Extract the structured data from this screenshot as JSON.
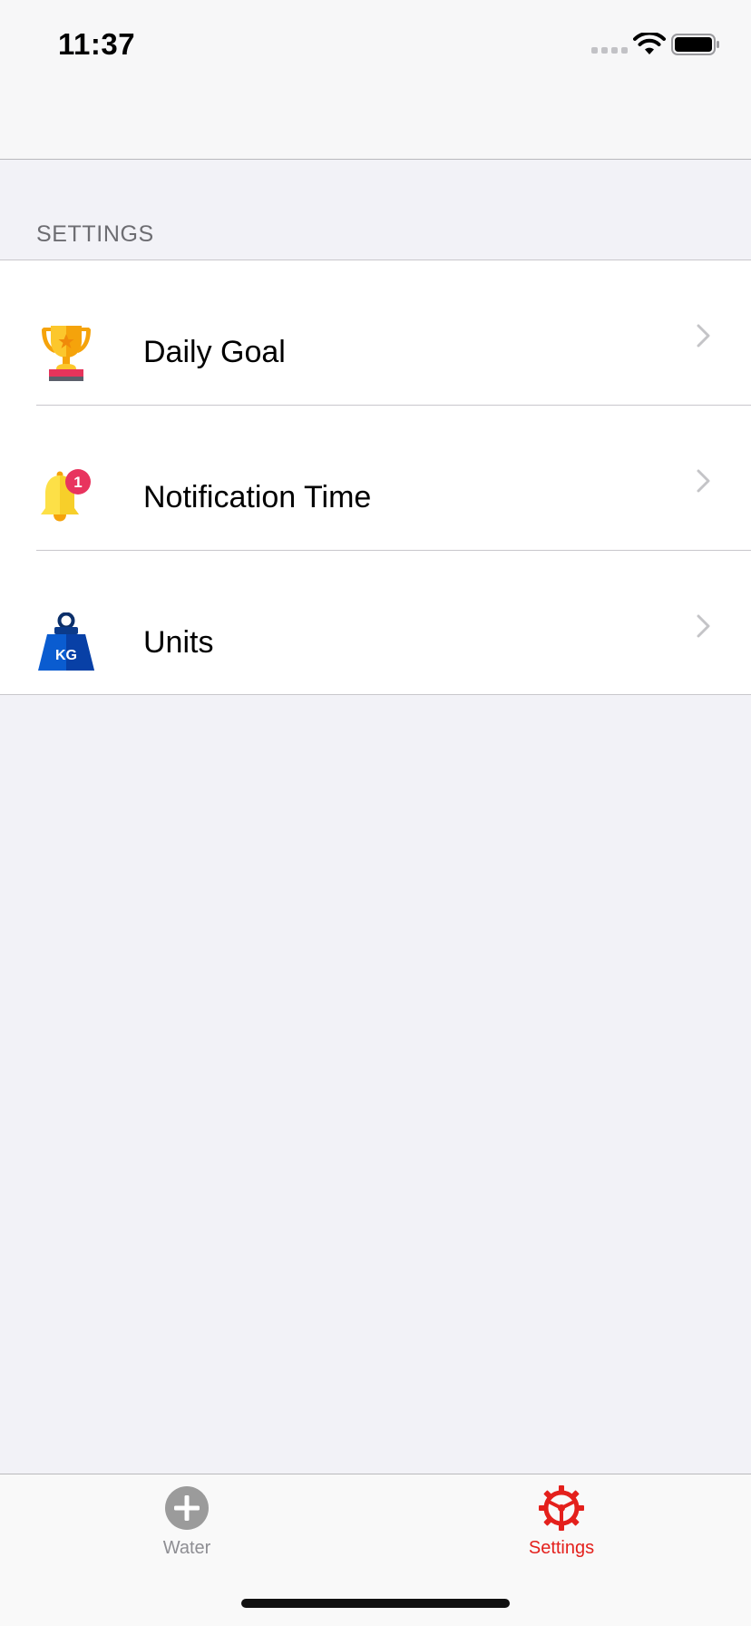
{
  "status_bar": {
    "time": "11:37"
  },
  "section": {
    "header": "SETTINGS"
  },
  "settings": {
    "items": [
      {
        "label": "Daily Goal",
        "icon": "trophy-icon"
      },
      {
        "label": "Notification Time",
        "icon": "bell-icon",
        "badge": "1"
      },
      {
        "label": "Units",
        "icon": "weight-icon",
        "icon_text": "KG"
      }
    ]
  },
  "tabbar": {
    "tabs": [
      {
        "label": "Water",
        "icon": "plus-circle-icon",
        "selected": false
      },
      {
        "label": "Settings",
        "icon": "gear-icon",
        "selected": true
      }
    ],
    "active_color": "#e4201c",
    "inactive_color": "#8e8e93"
  }
}
